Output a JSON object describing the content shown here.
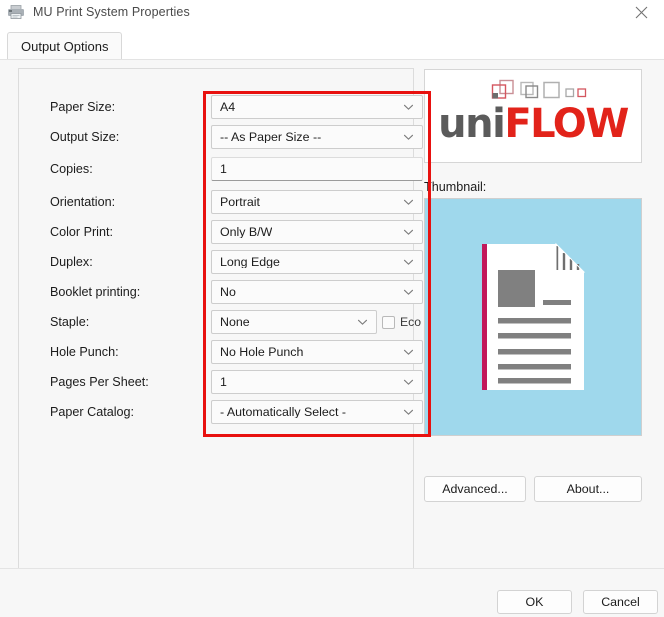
{
  "window": {
    "title": "MU Print System Properties",
    "icon": "printer-icon",
    "close_icon": "close-icon"
  },
  "tabs": [
    {
      "label": "Output Options",
      "active": true
    }
  ],
  "colors": {
    "accent_red": "#e8110f",
    "logo_red": "#e2231a",
    "logo_gray": "#5b5b5b",
    "thumbnail_background": "#9fd8ec",
    "page_spine": "#c2185b",
    "dialog_background": "#f7f7f7"
  },
  "form": {
    "rows": [
      {
        "label": "Paper Size:",
        "control": "combo",
        "value": "A4",
        "name": "paper-size"
      },
      {
        "label": "Output Size:",
        "control": "combo",
        "value": "-- As Paper Size --",
        "name": "output-size"
      },
      {
        "label": "Copies:",
        "control": "text",
        "value": "1",
        "name": "copies"
      },
      {
        "label": "Orientation:",
        "control": "combo",
        "value": "Portrait",
        "name": "orientation"
      },
      {
        "label": "Color Print:",
        "control": "combo",
        "value": "Only B/W",
        "name": "color-print"
      },
      {
        "label": "Duplex:",
        "control": "combo",
        "value": "Long Edge",
        "name": "duplex"
      },
      {
        "label": "Booklet printing:",
        "control": "combo",
        "value": "No",
        "name": "booklet-printing"
      },
      {
        "label": "Staple:",
        "control": "combo",
        "value": "None",
        "name": "staple"
      },
      {
        "label": "Hole Punch:",
        "control": "combo",
        "value": "No Hole Punch",
        "name": "hole-punch"
      },
      {
        "label": "Pages Per Sheet:",
        "control": "combo",
        "value": "1",
        "name": "pages-per-sheet"
      },
      {
        "label": "Paper Catalog:",
        "control": "combo",
        "value": "- Automatically Select -",
        "name": "paper-catalog"
      }
    ],
    "eco": {
      "label": "Eco",
      "checked": false
    }
  },
  "logo": {
    "text_part1": "uni",
    "text_part2": "FLOW"
  },
  "preview": {
    "thumbnail_label": "Thumbnail:"
  },
  "buttons": {
    "advanced": "Advanced...",
    "about": "About...",
    "ok": "OK",
    "cancel": "Cancel"
  }
}
